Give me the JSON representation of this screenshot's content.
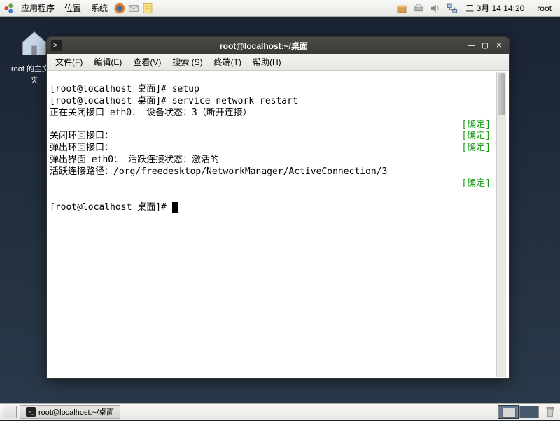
{
  "top_panel": {
    "menus": {
      "apps": "应用程序",
      "places": "位置",
      "system": "系统"
    },
    "date": "三 3月 14 14:20",
    "user": "root"
  },
  "desktop": {
    "icon1_label": "root 的主文件夹"
  },
  "terminal": {
    "title": "root@localhost:~/桌面",
    "menubar": {
      "file": "文件(F)",
      "edit": "编辑(E)",
      "view": "查看(V)",
      "search": "搜索 (S)",
      "terminal": "终端(T)",
      "help": "帮助(H)"
    },
    "lines": {
      "l1": "[root@localhost 桌面]# setup",
      "l2": "[root@localhost 桌面]# service network restart",
      "l3_left": "正在关闭接口 eth0： 设备状态：3（断开连接）",
      "l4_left": "",
      "l5_left": "关闭环回接口：",
      "l6_left": "弹出环回接口：",
      "l7_left": "弹出界面 eth0： 活跃连接状态：激活的",
      "l8_left": "活跃连接路径：/org/freedesktop/NetworkManager/ActiveConnection/3",
      "l9_left": "",
      "prompt": "[root@localhost 桌面]# ",
      "ok": "[确定]"
    }
  },
  "bottom_panel": {
    "task_label": "root@localhost:~/桌面"
  }
}
